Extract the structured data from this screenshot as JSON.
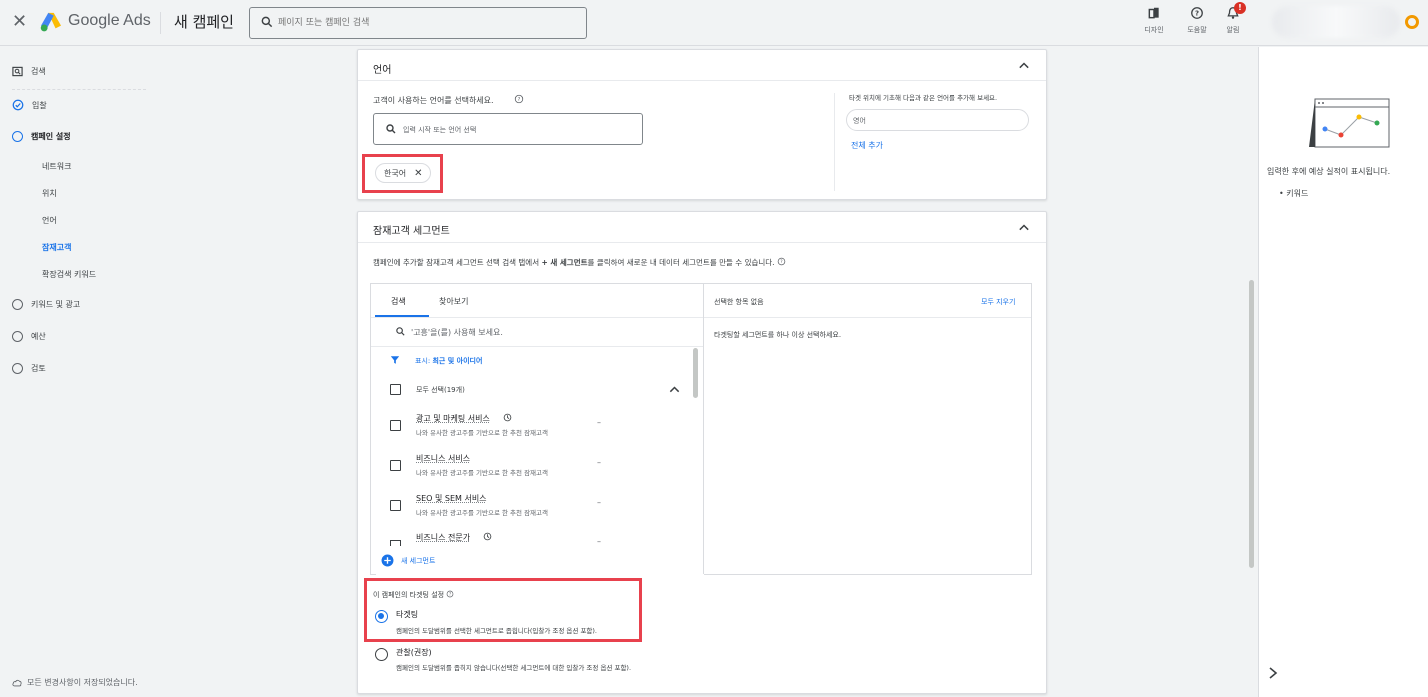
{
  "topbar": {
    "brand": "Google Ads",
    "page_title": "새 캠페인",
    "search_placeholder": "페이지 또는 캠페인 검색",
    "tools": [
      {
        "label": "디자인",
        "icon": "design-icon"
      },
      {
        "label": "도움말",
        "icon": "help-icon"
      },
      {
        "label": "알림",
        "icon": "bell-icon",
        "badge": "!"
      }
    ]
  },
  "nav": {
    "items": [
      {
        "label": "검색",
        "icon": "search-campaign-icon"
      },
      {
        "label": "입찰",
        "state": "done"
      },
      {
        "label": "캠페인 설정",
        "state": "current"
      },
      {
        "label": "키워드 및 광고",
        "state": "todo"
      },
      {
        "label": "예산",
        "state": "todo"
      },
      {
        "label": "검토",
        "state": "todo"
      }
    ],
    "sub_items": [
      "네트워크",
      "위치",
      "언어",
      "잠재고객",
      "확장검색 키워드"
    ],
    "active_sub": "잠재고객",
    "saved_text": "모든 변경사항이 저장되었습니다."
  },
  "language_card": {
    "title": "언어",
    "prompt": "고객이 사용하는 언어를 선택하세요.",
    "input_placeholder": "입력 시작 또는 언어 선택",
    "chip": "한국어",
    "suggest_text": "타겟 위치에 기초해 다음과 같은 언어를 추가해 보세요.",
    "suggest_pill": "영어",
    "add_all": "전체 추가"
  },
  "audience_card": {
    "title": "잠재고객 세그먼트",
    "description_pre": "캠페인에 추가할 잠재고객 세그먼트 선택 검색 탭에서 ",
    "description_bold": "+ 새 세그먼트",
    "description_post": "를 클릭하여 새로운 내 데이터 세그먼트를 만들 수 있습니다.",
    "tabs": [
      "검색",
      "찾아보기"
    ],
    "search_placeholder": "'고흥'을(를) 사용해 보세요.",
    "filter_prefix": "표시:",
    "filter_value": "최근 및 아이디어",
    "select_all": "모두 선택(19개)",
    "segments": [
      {
        "name": "광고 및 마케팅 서비스",
        "desc": "나와 유사한 광고주를 기반으로 한 추천 잠재고객",
        "value": "–",
        "clock": true
      },
      {
        "name": "비즈니스 서비스",
        "desc": "나와 유사한 광고주를 기반으로 한 추천 잠재고객",
        "value": "–",
        "clock": false
      },
      {
        "name": "SEO 및 SEM 서비스",
        "desc": "나와 유사한 광고주를 기반으로 한 추천 잠재고객",
        "value": "–",
        "clock": false
      },
      {
        "name": "비즈니스 전문가",
        "desc": "",
        "value": "–",
        "clock": true
      }
    ],
    "new_segment": "새 세그먼트",
    "selected_title": "선택한 항목 없음",
    "clear_all": "모두 지우기",
    "selected_empty": "타겟팅할 세그먼트를 하나 이상 선택하세요.",
    "targeting_title": "이 캠페인의 타겟팅 설정",
    "options": [
      {
        "label": "타겟팅",
        "desc": "캠페인의 도달범위를 선택한 세그먼트로 좁힙니다(입찰가 조정 옵션 포함).",
        "selected": true
      },
      {
        "label": "관찰(권장)",
        "desc": "캠페인의 도달범위를 좁히지 않습니다(선택한 세그먼트에 대한 입찰가 조정 옵션 포함).",
        "selected": false
      }
    ]
  },
  "right_panel": {
    "text": "입력한 후에 예상 실적이 표시됩니다.",
    "bullet": "키워드"
  },
  "colors": {
    "accent": "#1a73e8",
    "highlight": "#e8414d"
  }
}
